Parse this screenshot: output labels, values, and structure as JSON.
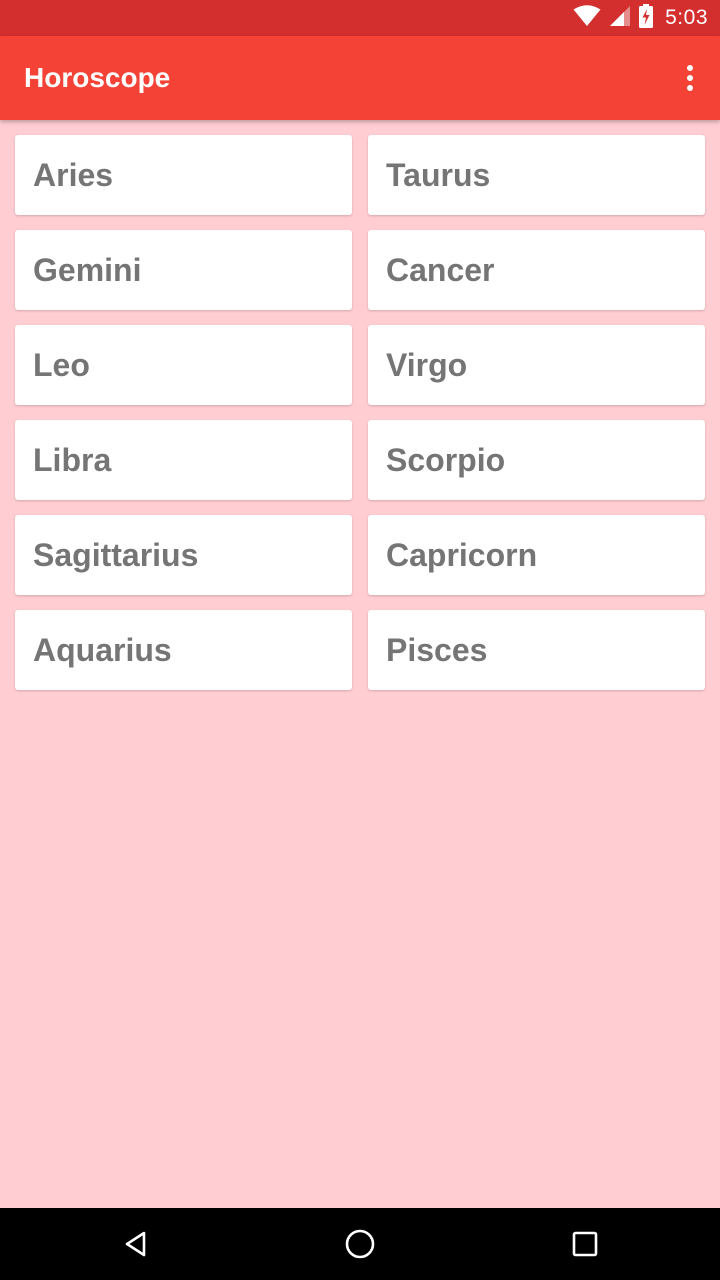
{
  "status_bar": {
    "time": "5:03",
    "icons": [
      "wifi-icon",
      "cell-signal-icon",
      "battery-charging-icon"
    ]
  },
  "app_bar": {
    "title": "Horoscope",
    "menu_icon": "more-vert-icon"
  },
  "signs": [
    {
      "label": "Aries"
    },
    {
      "label": "Taurus"
    },
    {
      "label": "Gemini"
    },
    {
      "label": "Cancer"
    },
    {
      "label": "Leo"
    },
    {
      "label": "Virgo"
    },
    {
      "label": "Libra"
    },
    {
      "label": "Scorpio"
    },
    {
      "label": "Sagittarius"
    },
    {
      "label": "Capricorn"
    },
    {
      "label": "Aquarius"
    },
    {
      "label": "Pisces"
    }
  ],
  "nav_bar": {
    "buttons": [
      "back-icon",
      "home-icon",
      "recents-icon"
    ]
  },
  "colors": {
    "status_bar": "#d32f2f",
    "app_bar": "#f44336",
    "background": "#ffcdd2",
    "card": "#ffffff",
    "card_text": "#757575"
  }
}
